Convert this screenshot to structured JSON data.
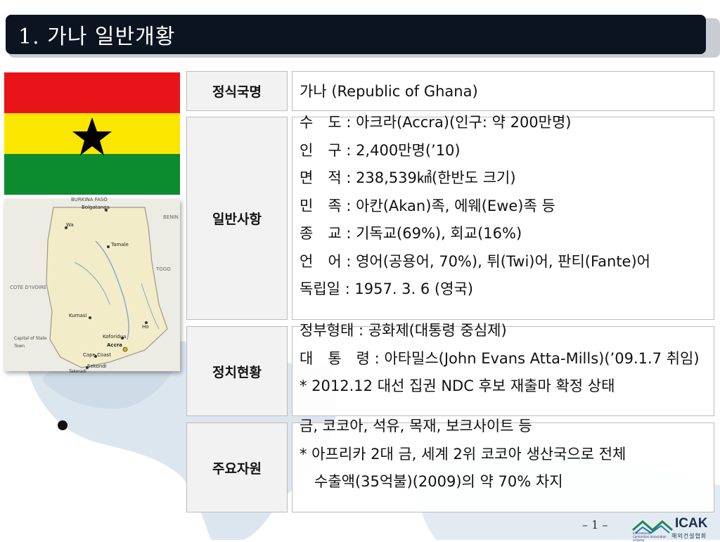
{
  "header": {
    "title": "1. 가나 일반개황"
  },
  "map_labels": {
    "burkina": "BURKINA FASO",
    "bolgatanga": "Bolgatanga",
    "wa": "Wa",
    "tamale": "Tamale",
    "benin": "BENIN",
    "togo": "TOGO",
    "cote": "COTE D'IVOIRE",
    "kumasi": "Kumasi",
    "ho": "Ho",
    "koforidua": "Koforidua",
    "accra": "Accra",
    "cape_coast": "Cape Coast",
    "sekondi": "Sekondi",
    "takoradi": "Takoradi",
    "legend_capital": "Capital of State",
    "legend_town": "Town"
  },
  "rows": [
    {
      "label": "정식국명",
      "lines": [
        "가나 (Republic of Ghana)"
      ]
    },
    {
      "label": "일반사항",
      "lines": [
        "수　도 : 아크라(Accra)(인구: 약 200만명)",
        "인　구 : 2,400만명(’10)",
        "면　적 : 238,539㎢(한반도 크기)",
        "민　족 : 아칸(Akan)족, 에웨(Ewe)족 등",
        "종　교 : 기독교(69%), 회교(16%)",
        "언　어 : 영어(공용어, 70%), 튀(Twi)어, 판티(Fante)어",
        "독립일 : 1957. 3. 6 (영국)"
      ]
    },
    {
      "label": "정치현황",
      "lines": [
        "정부형태 : 공화제(대통령 중심제)",
        "대　통　령 : 아타밀스(John Evans Atta-Mills)(’09.1.7 취임)",
        "* 2012.12 대선 집권 NDC 후보 재출마  확정 상태"
      ]
    },
    {
      "label": "주요자원",
      "lines": [
        "금, 코코아, 석유, 목재, 보크사이트 등",
        "* 아프리카 2대 금, 세계 2위 코코아 생산국으로 전체",
        "　수출액(35억불)(2009)의 약 70% 차지"
      ]
    }
  ],
  "footer": {
    "page": "– 1 –",
    "logo_text": "ICAK",
    "logo_sub": "해외건설협회",
    "logo_small": "International Contractors Association of Korea"
  },
  "colors": {
    "title_bg": "#0c1422",
    "flag_red": "#e8141a",
    "flag_yellow": "#fbe600",
    "flag_green": "#0d8c2f",
    "label_bg": "#f2f2f2"
  }
}
